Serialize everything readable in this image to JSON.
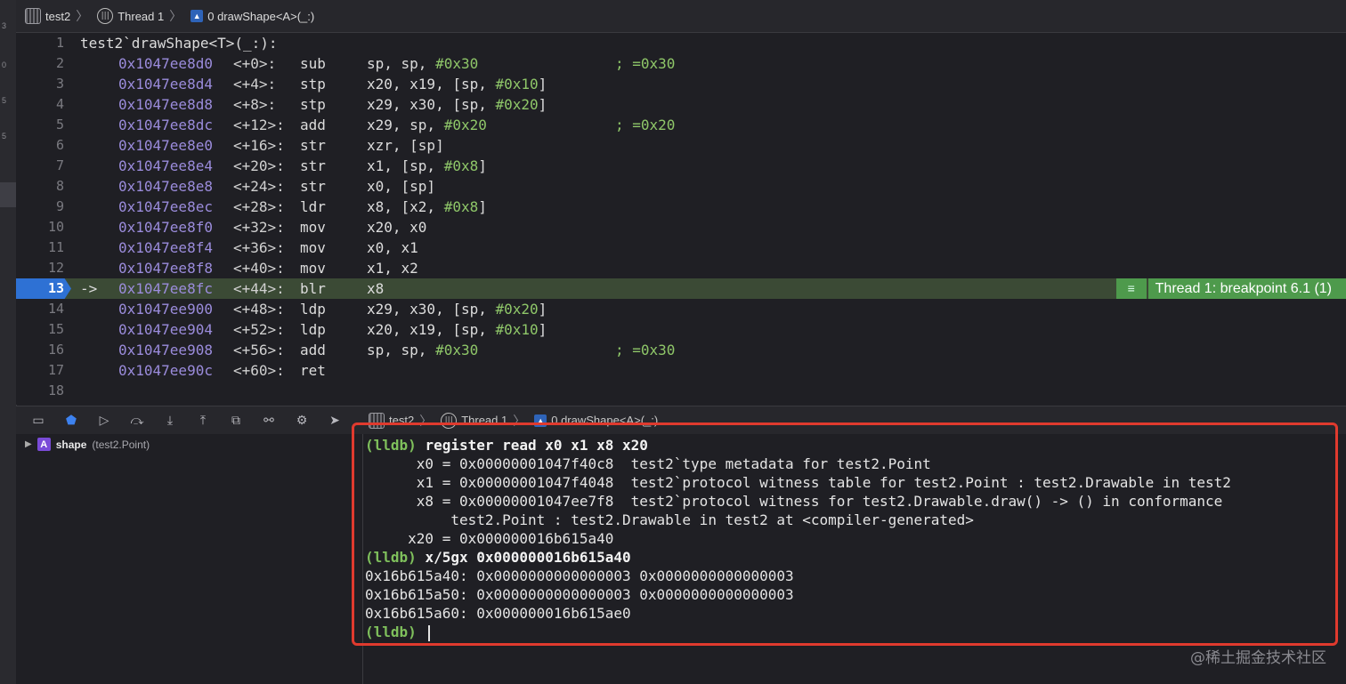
{
  "jumpbar": {
    "crumbs": [
      "test2",
      "Thread 1",
      "0 drawShape<A>(_:)"
    ]
  },
  "editor": {
    "lines": [
      {
        "n": "1",
        "header": "test2`drawShape<T>(_:):"
      },
      {
        "n": "2",
        "addr": "0x1047ee8d0",
        "off": "<+0>:",
        "op": "sub",
        "args": "sp, sp, ",
        "imm": "#0x30",
        "tail": "",
        "comment": "; =0x30"
      },
      {
        "n": "3",
        "addr": "0x1047ee8d4",
        "off": "<+4>:",
        "op": "stp",
        "args": "x20, x19, [sp, ",
        "imm": "#0x10",
        "tail": "]",
        "comment": ""
      },
      {
        "n": "4",
        "addr": "0x1047ee8d8",
        "off": "<+8>:",
        "op": "stp",
        "args": "x29, x30, [sp, ",
        "imm": "#0x20",
        "tail": "]",
        "comment": ""
      },
      {
        "n": "5",
        "addr": "0x1047ee8dc",
        "off": "<+12>:",
        "op": "add",
        "args": "x29, sp, ",
        "imm": "#0x20",
        "tail": "",
        "comment": "; =0x20"
      },
      {
        "n": "6",
        "addr": "0x1047ee8e0",
        "off": "<+16>:",
        "op": "str",
        "args": "xzr, [sp]",
        "imm": "",
        "tail": "",
        "comment": ""
      },
      {
        "n": "7",
        "addr": "0x1047ee8e4",
        "off": "<+20>:",
        "op": "str",
        "args": "x1, [sp, ",
        "imm": "#0x8",
        "tail": "]",
        "comment": ""
      },
      {
        "n": "8",
        "addr": "0x1047ee8e8",
        "off": "<+24>:",
        "op": "str",
        "args": "x0, [sp]",
        "imm": "",
        "tail": "",
        "comment": ""
      },
      {
        "n": "9",
        "addr": "0x1047ee8ec",
        "off": "<+28>:",
        "op": "ldr",
        "args": "x8, [x2, ",
        "imm": "#0x8",
        "tail": "]",
        "comment": ""
      },
      {
        "n": "10",
        "addr": "0x1047ee8f0",
        "off": "<+32>:",
        "op": "mov",
        "args": "x20, x0",
        "imm": "",
        "tail": "",
        "comment": ""
      },
      {
        "n": "11",
        "addr": "0x1047ee8f4",
        "off": "<+36>:",
        "op": "mov",
        "args": "x0, x1",
        "imm": "",
        "tail": "",
        "comment": ""
      },
      {
        "n": "12",
        "addr": "0x1047ee8f8",
        "off": "<+40>:",
        "op": "mov",
        "args": "x1, x2",
        "imm": "",
        "tail": "",
        "comment": ""
      },
      {
        "n": "13",
        "addr": "0x1047ee8fc",
        "off": "<+44>:",
        "op": "blr",
        "args": "x8",
        "imm": "",
        "tail": "",
        "comment": "",
        "current": true,
        "arrow": "->"
      },
      {
        "n": "14",
        "addr": "0x1047ee900",
        "off": "<+48>:",
        "op": "ldp",
        "args": "x29, x30, [sp, ",
        "imm": "#0x20",
        "tail": "]",
        "comment": ""
      },
      {
        "n": "15",
        "addr": "0x1047ee904",
        "off": "<+52>:",
        "op": "ldp",
        "args": "x20, x19, [sp, ",
        "imm": "#0x10",
        "tail": "]",
        "comment": ""
      },
      {
        "n": "16",
        "addr": "0x1047ee908",
        "off": "<+56>:",
        "op": "add",
        "args": "sp, sp, ",
        "imm": "#0x30",
        "tail": "",
        "comment": "; =0x30"
      },
      {
        "n": "17",
        "addr": "0x1047ee90c",
        "off": "<+60>:",
        "op": "ret",
        "args": "",
        "imm": "",
        "tail": "",
        "comment": ""
      },
      {
        "n": "18"
      }
    ],
    "breakpoint_label": "Thread 1: breakpoint 6.1 (1)"
  },
  "debugbar": {
    "crumbs": [
      "test2",
      "Thread 1",
      "0 drawShape<A>(_:)"
    ]
  },
  "variables": {
    "badge": "A",
    "name": "shape",
    "type": "(test2.Point)"
  },
  "console": {
    "prompt": "(lldb)",
    "cmd1": "register read x0 x1 x8 x20",
    "reg_lines": [
      "      x0 = 0x00000001047f40c8  test2`type metadata for test2.Point",
      "      x1 = 0x00000001047f4048  test2`protocol witness table for test2.Point : test2.Drawable in test2",
      "      x8 = 0x00000001047ee7f8  test2`protocol witness for test2.Drawable.draw() -> () in conformance",
      "          test2.Point : test2.Drawable in test2 at <compiler-generated>",
      "     x20 = 0x000000016b615a40"
    ],
    "cmd2": "x/5gx 0x000000016b615a40",
    "mem_lines": [
      "0x16b615a40: 0x0000000000000003 0x0000000000000003",
      "0x16b615a50: 0x0000000000000003 0x0000000000000003",
      "0x16b615a60: 0x000000016b615ae0"
    ]
  },
  "watermark": "@稀土掘金技术社区",
  "colors": {
    "breakpoint_blue": "#2e71d4",
    "breakpoint_green": "#4e9a4c",
    "highlight_red": "#e03a2e",
    "lldb_green": "#7fc05c"
  }
}
